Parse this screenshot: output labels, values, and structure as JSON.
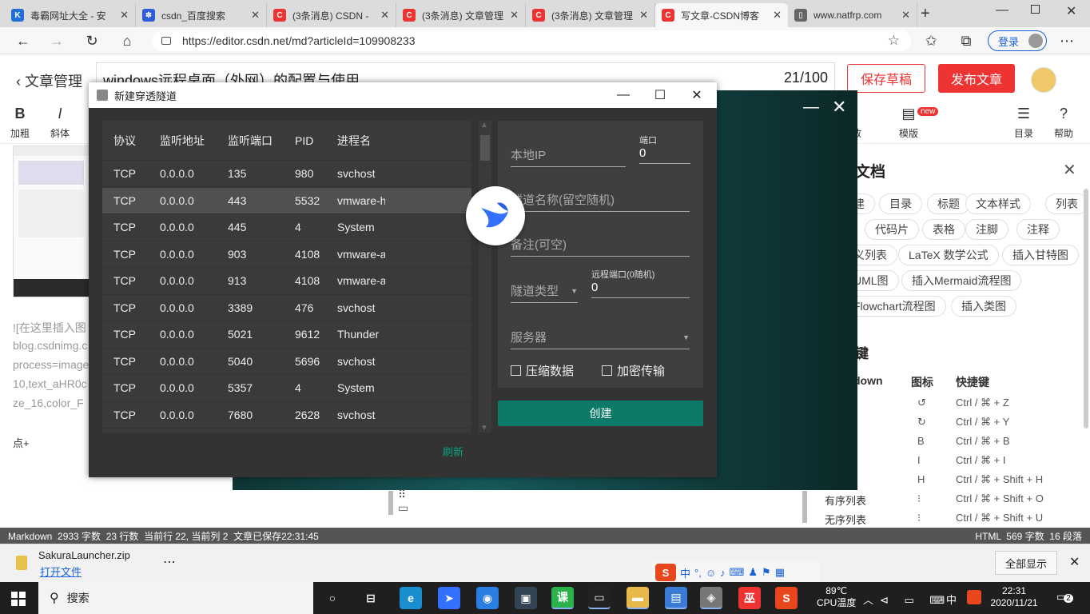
{
  "tabs": [
    {
      "title": "毒霸网址大全 - 安",
      "color": "#1f6fd6",
      "glyph": "K"
    },
    {
      "title": "csdn_百度搜索",
      "color": "#2f5cd9",
      "glyph": "✽"
    },
    {
      "title": "(3条消息) CSDN -",
      "color": "#e33",
      "glyph": "C"
    },
    {
      "title": "(3条消息) 文章管理",
      "color": "#e33",
      "glyph": "C"
    },
    {
      "title": "(3条消息) 文章管理",
      "color": "#e33",
      "glyph": "C"
    },
    {
      "title": "写文章-CSDN博客",
      "color": "#e33",
      "glyph": "C"
    },
    {
      "title": "www.natfrp.com",
      "color": "#666",
      "glyph": "▯"
    }
  ],
  "address": {
    "url": "https://editor.csdn.net/md?articleId=109908233",
    "login": "登录"
  },
  "editor": {
    "back": "文章管理",
    "title": "windows远程桌面（外网）的配置与使用",
    "counter": "21/100",
    "save": "保存草稿",
    "publish": "发布文章"
  },
  "toolbar": {
    "bold": "加粗",
    "italic": "斜体",
    "template": "模版",
    "template_badge": "new",
    "toc": "目录",
    "help": "帮助",
    "partial": "敌"
  },
  "left": {
    "lines": [
      "![在这里插入图",
      "blog.csdnimg.c",
      "process=image",
      "10,text_aHR0c",
      "ze_16,color_F"
    ],
    "tail": "点+"
  },
  "help": {
    "title": "文档",
    "chips": [
      "建",
      "目录",
      "标题",
      "文本样式",
      "列表",
      "代码片",
      "表格",
      "注脚",
      "注释",
      "义列表",
      "LaTeX 数学公式",
      "插入甘特图",
      "UML图",
      "插入Mermaid流程图",
      "Flowchart流程图",
      "插入类图"
    ],
    "shortcut_title": "键",
    "col1": "down",
    "col2": "图标",
    "col3": "快捷键",
    "rows": [
      {
        "icon": "↺",
        "key": "Ctrl / ⌘ + Z",
        "name": ""
      },
      {
        "icon": "↻",
        "key": "Ctrl / ⌘ + Y",
        "name": ""
      },
      {
        "icon": "B",
        "key": "Ctrl / ⌘ + B",
        "name": ""
      },
      {
        "icon": "I",
        "key": "Ctrl / ⌘ + I",
        "name": ""
      },
      {
        "icon": "H",
        "key": "Ctrl / ⌘ + Shift + H",
        "name": ""
      },
      {
        "icon": "⁝",
        "key": "Ctrl / ⌘ + Shift + O",
        "name": "有序列表"
      },
      {
        "icon": "⁝",
        "key": "Ctrl / ⌘ + Shift + U",
        "name": "无序列表"
      }
    ]
  },
  "dialog": {
    "title": "新建穿透隧道",
    "headers": [
      "协议",
      "监听地址",
      "监听端口",
      "PID",
      "进程名"
    ],
    "rows": [
      [
        "TCP",
        "0.0.0.0",
        "135",
        "980",
        "svchost"
      ],
      [
        "TCP",
        "0.0.0.0",
        "443",
        "5532",
        "vmware-h"
      ],
      [
        "TCP",
        "0.0.0.0",
        "445",
        "4",
        "System"
      ],
      [
        "TCP",
        "0.0.0.0",
        "903",
        "4108",
        "vmware-a"
      ],
      [
        "TCP",
        "0.0.0.0",
        "913",
        "4108",
        "vmware-a"
      ],
      [
        "TCP",
        "0.0.0.0",
        "3389",
        "476",
        "svchost"
      ],
      [
        "TCP",
        "0.0.0.0",
        "5021",
        "9612",
        "Thunder"
      ],
      [
        "TCP",
        "0.0.0.0",
        "5040",
        "5696",
        "svchost"
      ],
      [
        "TCP",
        "0.0.0.0",
        "5357",
        "4",
        "System"
      ],
      [
        "TCP",
        "0.0.0.0",
        "7680",
        "2628",
        "svchost"
      ]
    ],
    "local_ip": "本地IP",
    "port_label": "端口",
    "port_value": "0",
    "tunnel_name": "隧道名称(留空随机)",
    "note": "备注(可空)",
    "type": "隧道类型",
    "remote_port_label": "远程端口(0随机)",
    "remote_port_value": "0",
    "server": "服务器",
    "compress": "压缩数据",
    "encrypt": "加密传输",
    "create": "创建",
    "refresh": "刷新"
  },
  "status": {
    "left": "Markdown  2933 字数  23 行数  当前行 22, 当前列 2  文章已保存22:31:45",
    "right": "HTML  569 字数  16 段落"
  },
  "download": {
    "file": "SakuraLauncher.zip",
    "open": "打开文件",
    "showall": "全部显示"
  },
  "ime": {
    "lang": "中"
  },
  "taskbar": {
    "search": "搜索",
    "temp": "89℃",
    "temp_label": "CPU温度",
    "lang": "中",
    "time": "22:31",
    "date": "2020/11/21",
    "notif": "2"
  }
}
